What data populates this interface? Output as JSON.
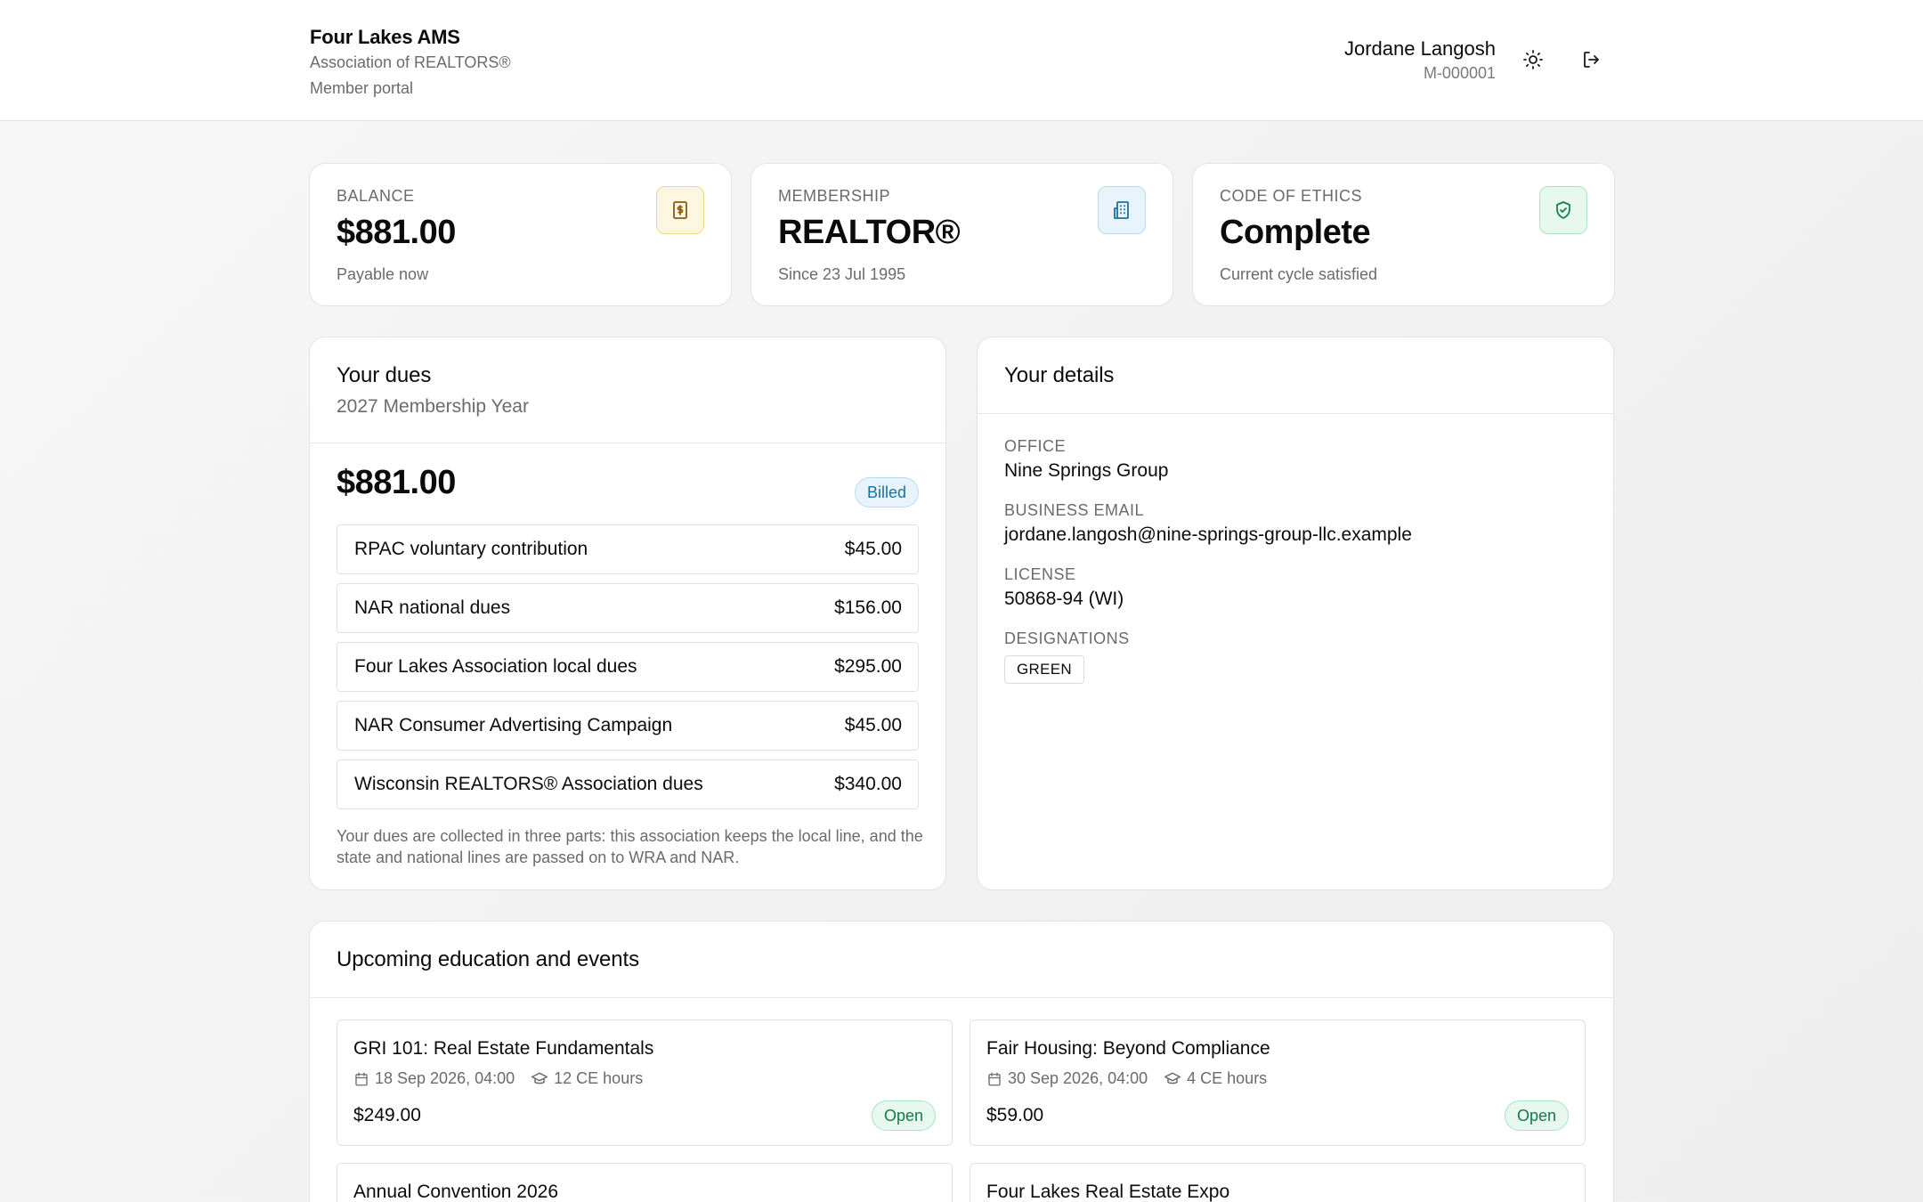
{
  "header": {
    "org_name": "Four Lakes AMS",
    "org_sub": "Association of REALTORS®",
    "portal": "Member portal",
    "user_name": "Jordane Langosh",
    "member_id": "M-000001",
    "theme_icon": "sun-icon",
    "logout_icon": "logout-icon"
  },
  "stats": [
    {
      "label": "BALANCE",
      "value": "$881.00",
      "sub": "Payable now",
      "icon": "dollar-document-icon",
      "accent": "#f1d58c"
    },
    {
      "label": "MEMBERSHIP",
      "value": "REALTOR®",
      "sub": "Since 23 Jul 1995",
      "icon": "building-icon",
      "accent": "#b7d9f0"
    },
    {
      "label": "CODE OF ETHICS",
      "value": "Complete",
      "sub": "Current cycle satisfied",
      "icon": "shield-check-icon",
      "accent": "#a7e3c3"
    }
  ],
  "dues": {
    "title": "Your dues",
    "subtitle": "2027 Membership Year",
    "total": "$881.00",
    "status": "Billed",
    "items": [
      {
        "name": "RPAC voluntary contribution",
        "amount": "$45.00"
      },
      {
        "name": "NAR national dues",
        "amount": "$156.00"
      },
      {
        "name": "Four Lakes Association local dues",
        "amount": "$295.00"
      },
      {
        "name": "NAR Consumer Advertising Campaign",
        "amount": "$45.00"
      },
      {
        "name": "Wisconsin REALTORS® Association dues",
        "amount": "$340.00"
      }
    ],
    "note": "Your dues are collected in three parts: this association keeps the local line, and the state and national lines are passed on to WRA and NAR."
  },
  "details": {
    "title": "Your details",
    "office_label": "OFFICE",
    "office": "Nine Springs Group",
    "email_label": "BUSINESS EMAIL",
    "email": "jordane.langosh@nine-springs-group-llc.example",
    "license_label": "LICENSE",
    "license": "50868-94 (WI)",
    "designations_label": "DESIGNATIONS",
    "designations": [
      "GREEN"
    ]
  },
  "events": {
    "title": "Upcoming education and events",
    "items": [
      {
        "title": "GRI 101: Real Estate Fundamentals",
        "date": "18 Sep 2026, 04:00",
        "hours": "12 CE hours",
        "price": "$249.00",
        "status": "Open"
      },
      {
        "title": "Fair Housing: Beyond Compliance",
        "date": "30 Sep 2026, 04:00",
        "hours": "4 CE hours",
        "price": "$59.00",
        "status": "Open"
      },
      {
        "title": "Annual Convention 2026",
        "date": "",
        "hours": "",
        "price": "",
        "status": ""
      },
      {
        "title": "Four Lakes Real Estate Expo",
        "date": "",
        "hours": "",
        "price": "",
        "status": ""
      }
    ]
  }
}
